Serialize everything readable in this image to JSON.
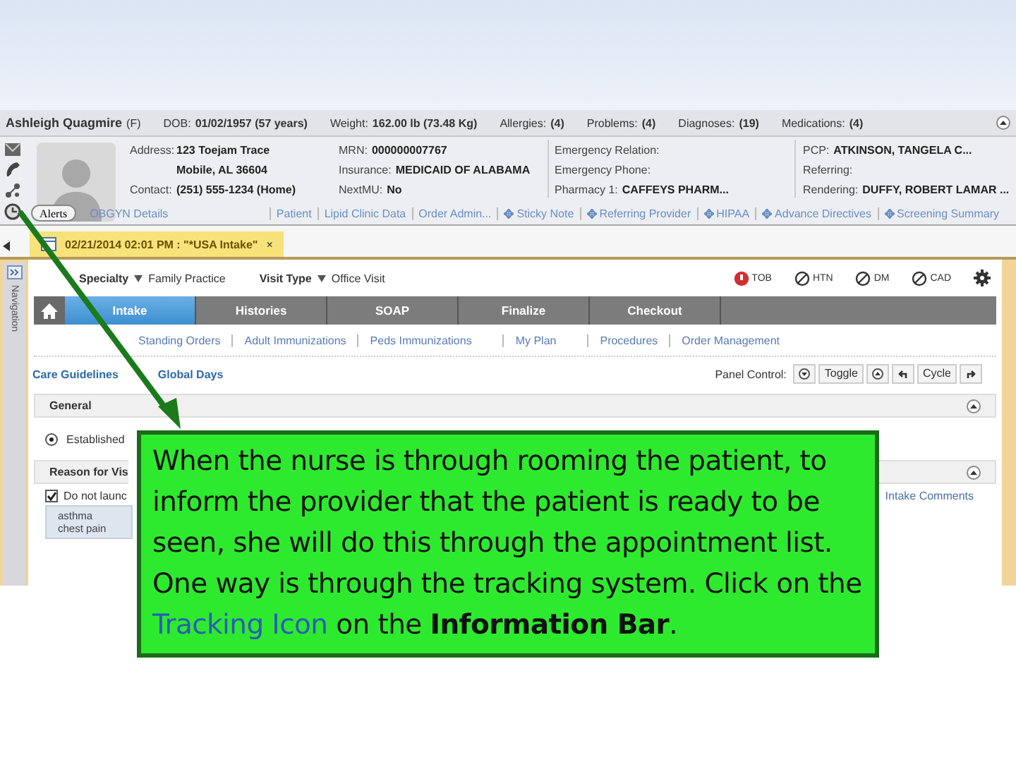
{
  "patient_bar": {
    "name": "Ashleigh Quagmire",
    "sex": "(F)",
    "dob_label": "DOB:",
    "dob": "01/02/1957 (57 years)",
    "weight_label": "Weight:",
    "weight": "162.00 lb (73.48 Kg)",
    "counts": [
      {
        "label": "Allergies:",
        "value": "(4)"
      },
      {
        "label": "Problems:",
        "value": "(4)"
      },
      {
        "label": "Diagnoses:",
        "value": "(19)"
      },
      {
        "label": "Medications:",
        "value": "(4)"
      }
    ]
  },
  "details": {
    "col1": [
      {
        "label": "Address:",
        "value": "123 Toejam Trace"
      },
      {
        "value": "Mobile, AL 36604"
      },
      {
        "label": "Contact:",
        "value": "(251) 555-1234 (Home)"
      }
    ],
    "col2": [
      {
        "label": "MRN:",
        "value": "000000007767"
      },
      {
        "label": "Insurance:",
        "value": "MEDICAID OF ALABAMA"
      },
      {
        "label": "NextMU:",
        "value": "No"
      }
    ],
    "col3": [
      {
        "label": "Emergency Relation:"
      },
      {
        "label": "Emergency Phone:"
      },
      {
        "label": "Pharmacy 1:",
        "value": "CAFFEYS PHARM..."
      }
    ],
    "col4": [
      {
        "label": "PCP:",
        "value": "ATKINSON, TANGELA C..."
      },
      {
        "label": "Referring:"
      },
      {
        "label": "Rendering:",
        "value": "DUFFY, ROBERT LAMAR ..."
      }
    ]
  },
  "alerts_button": "Alerts",
  "obgyn_link": "OBGYN Details",
  "info_links": [
    {
      "label": "Patient",
      "kind": "plain"
    },
    {
      "label": "Lipid Clinic Data",
      "kind": "plain"
    },
    {
      "label": "Order Admin...",
      "kind": "plain"
    },
    {
      "label": "Sticky Note",
      "kind": "flag"
    },
    {
      "label": "Referring Provider",
      "kind": "flag"
    },
    {
      "label": "HIPAA",
      "kind": "flag"
    },
    {
      "label": "Advance Directives",
      "kind": "flag"
    },
    {
      "label": "Screening Summary",
      "kind": "flag"
    }
  ],
  "encounter_tab": {
    "label": "02/21/2014 02:01 PM : \"*USA Intake\"",
    "close": "×"
  },
  "navigation_label": "Navigation",
  "visit": {
    "specialty_label": "Specialty",
    "specialty": "Family Practice",
    "visit_type_label": "Visit Type",
    "visit_type": "Office Visit"
  },
  "indicators": [
    {
      "label": "TOB",
      "flagged": true
    },
    {
      "label": "HTN",
      "flagged": false
    },
    {
      "label": "DM",
      "flagged": false
    },
    {
      "label": "CAD",
      "flagged": false
    }
  ],
  "tabs": [
    {
      "label": "Intake",
      "selected": true
    },
    {
      "label": "Histories",
      "selected": false
    },
    {
      "label": "SOAP",
      "selected": false
    },
    {
      "label": "Finalize",
      "selected": false
    },
    {
      "label": "Checkout",
      "selected": false
    }
  ],
  "subtabs": [
    "Standing Orders",
    "Adult Immunizations",
    "Peds Immunizations",
    "My Plan",
    "Procedures",
    "Order Management"
  ],
  "links": [
    "Care Guidelines",
    "Global Days"
  ],
  "panel_control": {
    "label": "Panel Control:",
    "toggle": "Toggle",
    "cycle": "Cycle"
  },
  "general": {
    "title": "General",
    "option": "Established",
    "option_selected": true
  },
  "reason": {
    "title": "Reason for Vis",
    "checkbox": "Do not launc",
    "checked": true,
    "items": [
      "asthma",
      "chest pain"
    ],
    "comments_link": "Intake Comments"
  },
  "callout": {
    "parts": [
      {
        "text": "When the nurse is through rooming the patient, to inform the provider that the patient is ready to be seen, she will do this through the appointment list.  One way is through the tracking system.  Click on the ",
        "kind": "plain"
      },
      {
        "text": "Tracking Icon",
        "kind": "highlight"
      },
      {
        "text": " on the ",
        "kind": "plain"
      },
      {
        "text": "Information Bar",
        "kind": "bold"
      },
      {
        "text": ".",
        "kind": "plain"
      }
    ]
  }
}
